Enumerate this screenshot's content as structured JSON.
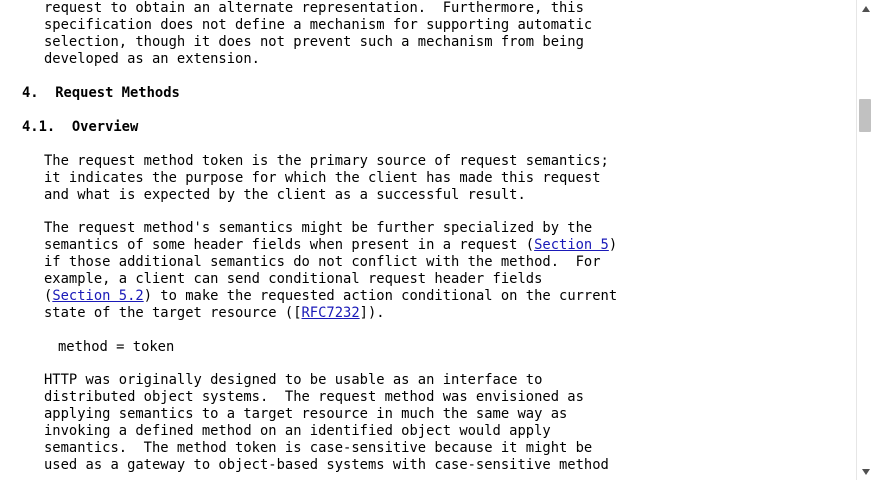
{
  "document": {
    "lines": [
      "request to obtain an alternate representation.  Furthermore, this",
      "specification does not define a mechanism for supporting automatic",
      "selection, though it does not prevent such a mechanism from being",
      "developed as an extension."
    ],
    "section4_heading": "4.  Request Methods",
    "section41_heading": "4.1.  Overview",
    "para1": [
      "The request method token is the primary source of request semantics;",
      "it indicates the purpose for which the client has made this request",
      "and what is expected by the client as a successful result."
    ],
    "para2": {
      "line1": "The request method's semantics might be further specialized by the",
      "line2_pre": "semantics of some header fields when present in a request (",
      "line2_link": "Section 5",
      "line2_post": ")",
      "line3": "if those additional semantics do not conflict with the method.  For",
      "line4": "example, a client can send conditional request header fields",
      "line5_pre": "(",
      "line5_link": "Section 5.2",
      "line5_post": ") to make the requested action conditional on the current",
      "line6_pre": "state of the target resource ([",
      "line6_link": "RFC7232",
      "line6_post": "])."
    },
    "abnf": "method = token",
    "para3": [
      "HTTP was originally designed to be usable as an interface to",
      "distributed object systems.  The request method was envisioned as",
      "applying semantics to a target resource in much the same way as",
      "invoking a defined method on an identified object would apply",
      "semantics.  The method token is case-sensitive because it might be",
      "used as a gateway to object-based systems with case-sensitive method"
    ]
  },
  "scrollbar": {
    "up_icon": "triangle-up-icon",
    "down_icon": "triangle-down-icon",
    "thumb_color": "#c1c1c1"
  },
  "colors": {
    "link": "#1a1ab8",
    "text": "#000000",
    "background": "#ffffff"
  }
}
